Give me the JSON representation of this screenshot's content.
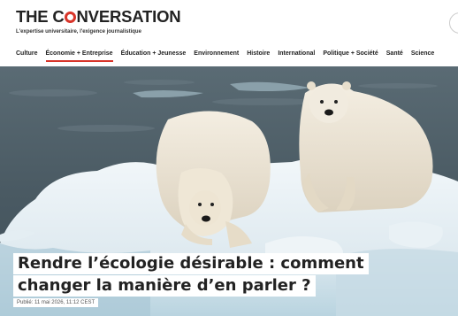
{
  "site": {
    "logo_pre": "THE C",
    "logo_post": "NVERSATION",
    "tagline": "L'expertise universitaire, l'exigence journalistique"
  },
  "nav": {
    "items": [
      {
        "label": "Culture"
      },
      {
        "label": "Économie + Entreprise",
        "active": true
      },
      {
        "label": "Éducation + Jeunesse"
      },
      {
        "label": "Environnement"
      },
      {
        "label": "Histoire"
      },
      {
        "label": "International"
      },
      {
        "label": "Politique + Société"
      },
      {
        "label": "Santé"
      },
      {
        "label": "Science"
      }
    ]
  },
  "article": {
    "title_line1": "Rendre l’écologie désirable : comment",
    "title_line2": "changer la manière d’en parler ?",
    "date": "Publié: 11 mai 2026, 11:12 CEST"
  },
  "colors": {
    "accent": "#d8352a",
    "text": "#222222"
  }
}
